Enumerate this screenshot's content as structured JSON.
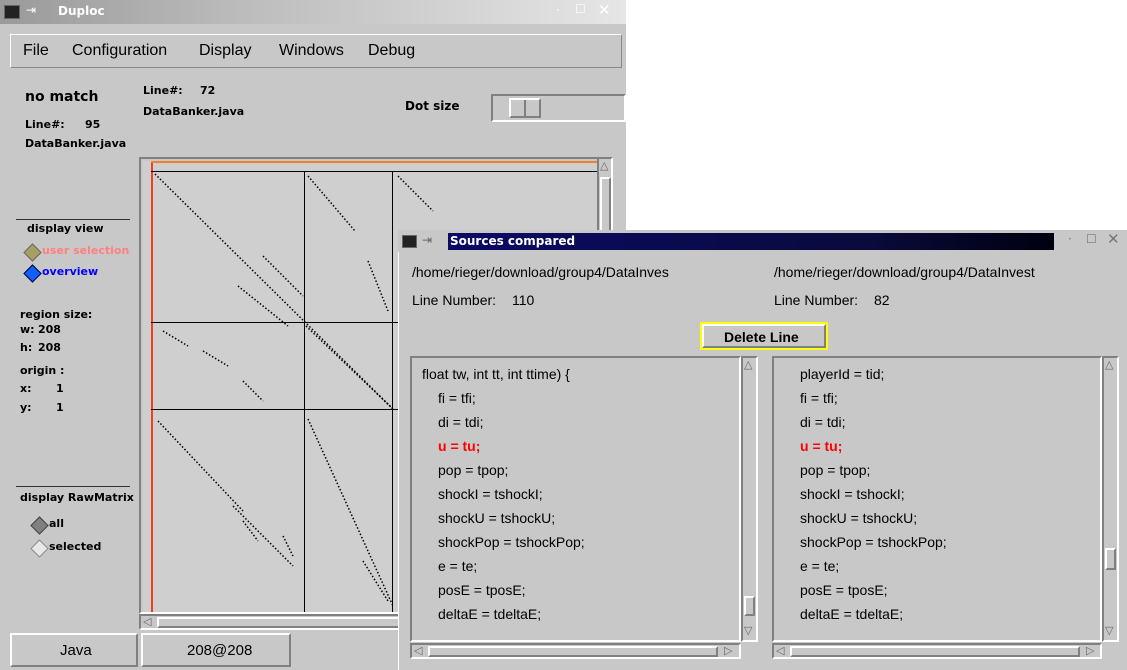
{
  "main_window": {
    "title": "Duploc",
    "menu": [
      "File",
      "Configuration",
      "Display",
      "Windows",
      "Debug"
    ],
    "match_status": "no match",
    "left_line_label": "Line#:",
    "left_line_value": "95",
    "left_file": "DataBanker.java",
    "top_line_label": "Line#:",
    "top_line_value": "72",
    "top_file": "DataBanker.java",
    "dot_size_label": "Dot size",
    "display_view_label": "display view",
    "view_options": [
      "user selection",
      "overview"
    ],
    "region_size_label": "region size:",
    "w_label": "w:",
    "w_value": "208",
    "h_label": "h:",
    "h_value": "208",
    "origin_label": "origin :",
    "x_label": "x:",
    "x_value": "1",
    "y_label": "y:",
    "y_value": "1",
    "raw_matrix_label": "display RawMatrix",
    "matrix_options": [
      "all",
      "selected"
    ],
    "status_language": "Java",
    "status_size": "208@208"
  },
  "compare_window": {
    "title": "Sources compared",
    "left_path": "/home/rieger/download/group4/DataInves",
    "right_path": "/home/rieger/download/group4/DataInvest",
    "left_line_label": "Line Number:",
    "left_line_value": "110",
    "right_line_label": "Line Number:",
    "right_line_value": "82",
    "delete_button": "Delete Line",
    "left_code": [
      "float tw, int tt, int ttime) {",
      "fi = tfi;",
      "di = tdi;",
      "u = tu;",
      "pop = tpop;",
      "shockI = tshockI;",
      "shockU = tshockU;",
      "shockPop = tshockPop;",
      "e = te;",
      "posE = tposE;",
      "deltaE = tdeltaE;"
    ],
    "right_code": [
      "playerId = tid;",
      "fi = tfi;",
      "di = tdi;",
      "u = tu;",
      "pop = tpop;",
      "shockI = tshockI;",
      "shockU = tshockU;",
      "shockPop = tshockPop;",
      "e = te;",
      "posE = tposE;",
      "deltaE = tdeltaE;"
    ],
    "highlight_line_index": 3,
    "highlight_color": "#ff0000"
  },
  "colors": {
    "selection_accent": "#ff8080",
    "overview_accent": "#0000ff",
    "frame_orange": "#f08030",
    "delete_button_border": "#ffff00"
  }
}
